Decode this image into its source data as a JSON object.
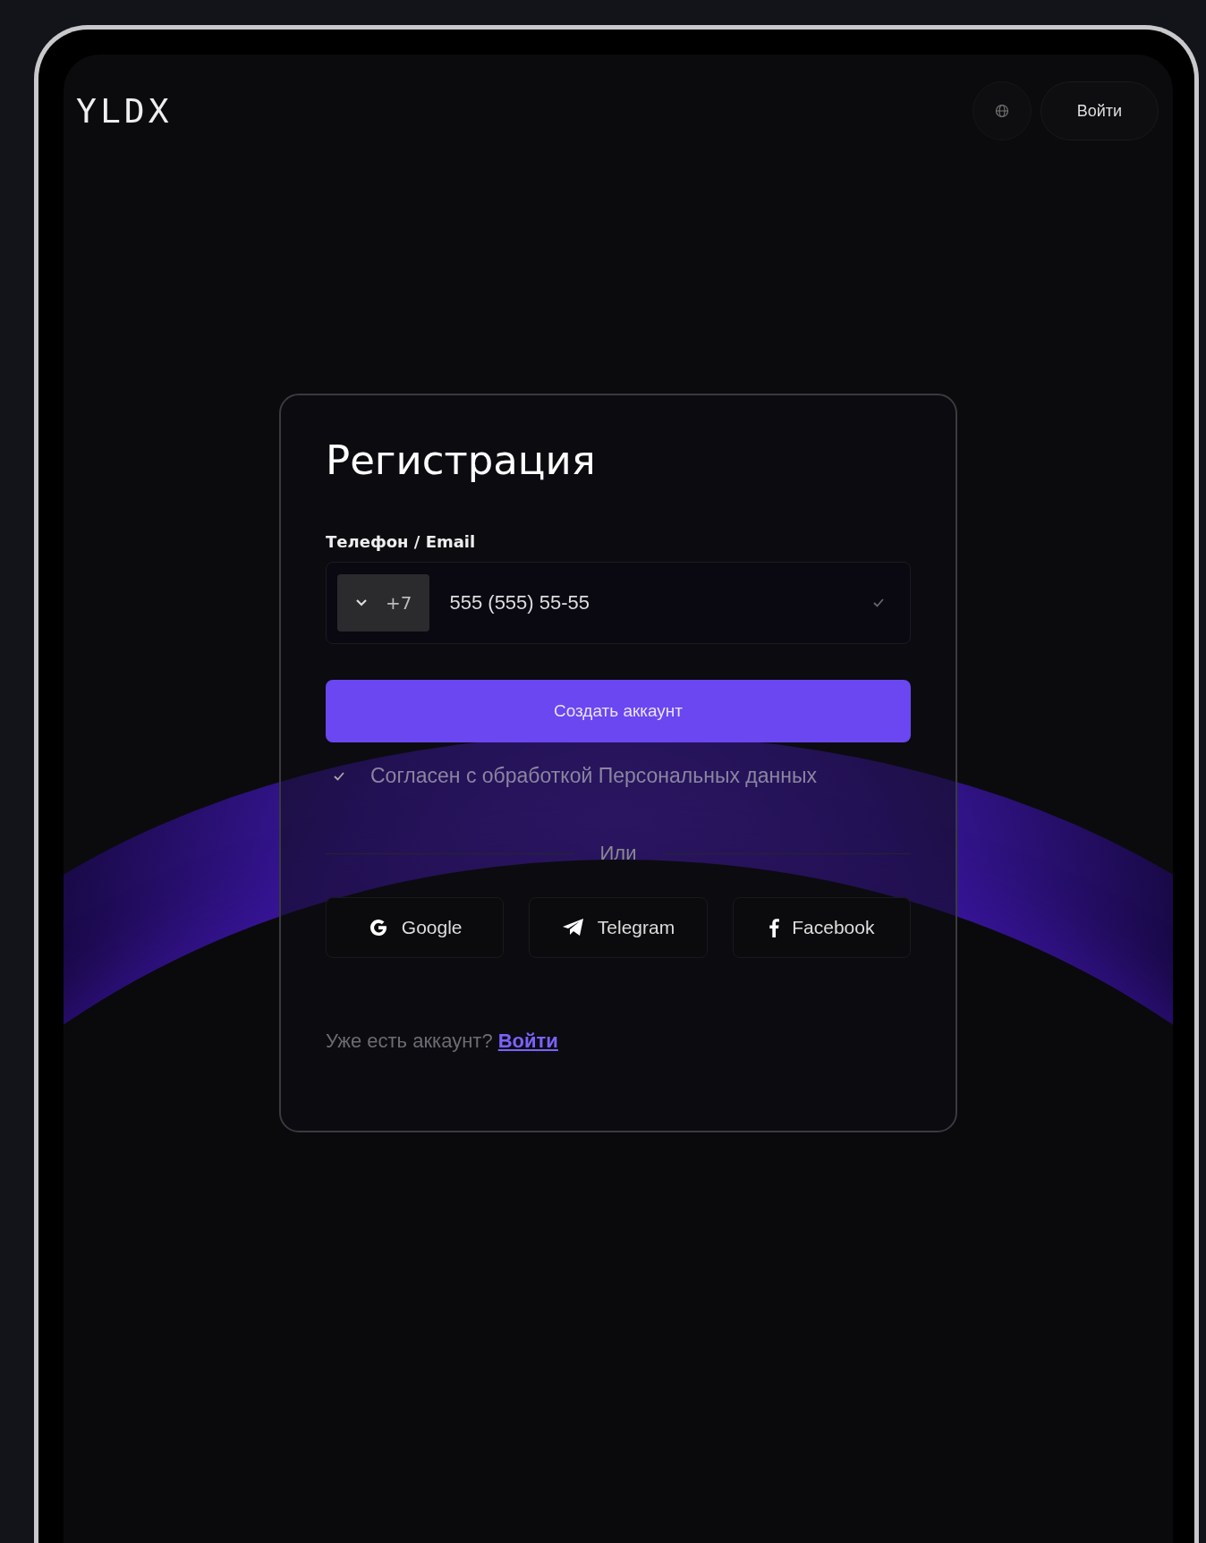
{
  "header": {
    "logo": "YLDX",
    "login_button": "Войти"
  },
  "form": {
    "title": "Регистрация",
    "field_label": "Телефон / Email",
    "phone": {
      "country_code": "+7",
      "value": "555 (555) 55-55",
      "valid": true
    },
    "submit": "Создать аккаунт",
    "consent": {
      "label": "Согласен с обработкой Персональных данных",
      "checked": true
    },
    "divider": "Или",
    "social": [
      {
        "kind": "google",
        "label": "Google"
      },
      {
        "kind": "telegram",
        "label": "Telegram"
      },
      {
        "kind": "facebook",
        "label": "Facebook"
      }
    ],
    "footer": {
      "text": "Уже есть аккаунт?",
      "link": "Войти"
    }
  }
}
